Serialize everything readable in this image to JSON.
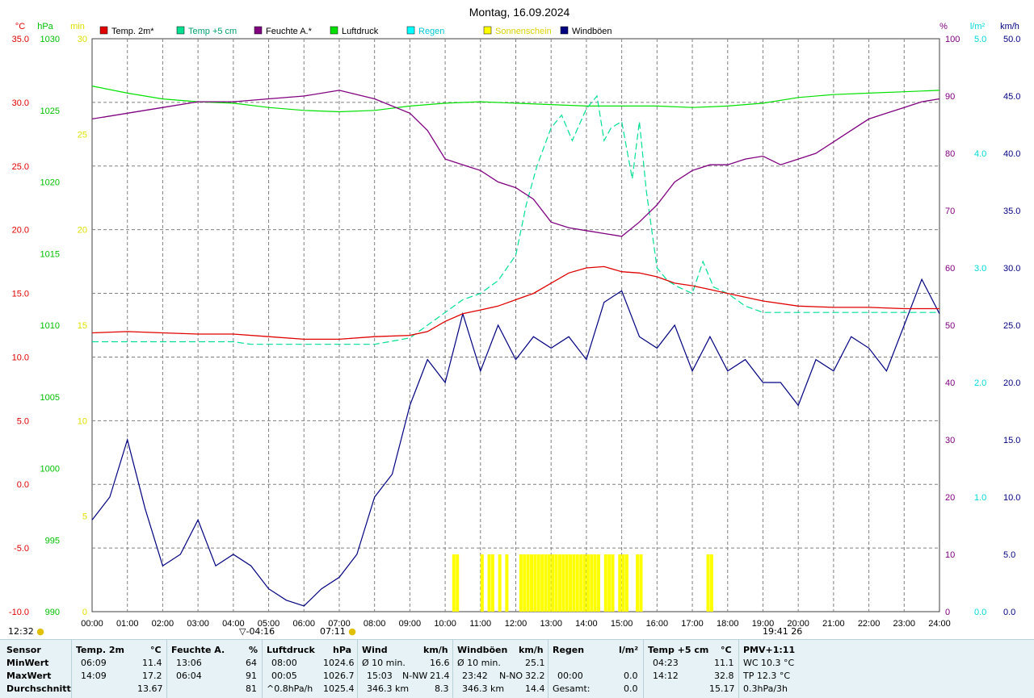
{
  "title": "Montag, 16.09.2024",
  "colors": {
    "temp": "#e00000",
    "temp5": "#00e090",
    "humidity": "#800080",
    "pressure": "#00e000",
    "rain": "#00ffff",
    "sun": "#ffff00",
    "gust": "#000080",
    "grid": "#808080",
    "panel_bg": "#e6f2f5"
  },
  "axes": {
    "temp_unit": "°C",
    "pressure_unit": "hPa",
    "sun_unit": "min",
    "hum_unit": "%",
    "rain_unit": "l/m²",
    "wind_unit": "km/h",
    "temp_ticks": [
      "35.0",
      "30.0",
      "25.0",
      "20.0",
      "15.0",
      "10.0",
      "5.0",
      "0.0",
      "-5.0",
      "-10.0"
    ],
    "pressure_ticks": [
      "1030",
      "1025",
      "1020",
      "1015",
      "1010",
      "1005",
      "1000",
      "995",
      "990"
    ],
    "sun_ticks": [
      "30",
      "25",
      "20",
      "15",
      "10",
      "5",
      "0"
    ],
    "hum_ticks": [
      "100",
      "90",
      "80",
      "70",
      "60",
      "50",
      "40",
      "30",
      "20",
      "10",
      "0"
    ],
    "rain_ticks": [
      "5.0",
      "4.0",
      "3.0",
      "2.0",
      "1.0",
      "0.0"
    ],
    "wind_ticks": [
      "50.0",
      "45.0",
      "40.0",
      "35.0",
      "30.0",
      "25.0",
      "20.0",
      "15.0",
      "10.0",
      "5.0",
      "0.0"
    ],
    "time_ticks": [
      "00:00",
      "01:00",
      "02:00",
      "03:00",
      "04:00",
      "05:00",
      "06:00",
      "07:00",
      "08:00",
      "09:00",
      "10:00",
      "11:00",
      "12:00",
      "13:00",
      "14:00",
      "15:00",
      "16:00",
      "17:00",
      "18:00",
      "19:00",
      "20:00",
      "21:00",
      "22:00",
      "23:00",
      "24:00"
    ]
  },
  "legend": [
    {
      "label": "Temp. 2m*",
      "color": "#e00000"
    },
    {
      "label": "Temp +5 cm",
      "color": "#00e090"
    },
    {
      "label": "Feuchte A.*",
      "color": "#800080"
    },
    {
      "label": "Luftdruck",
      "color": "#00e000"
    },
    {
      "label": "Regen",
      "color": "#00ffff"
    },
    {
      "label": "Sonnenschein",
      "color": "#ffff00"
    },
    {
      "label": "Windböen",
      "color": "#000080"
    }
  ],
  "markers": {
    "moonrise": "04:16",
    "sunrise": "07:11",
    "sunset": "19:41",
    "sunset_extra": "26",
    "corner_time": "12:32"
  },
  "chart_data": {
    "type": "line",
    "x_unit": "hour",
    "xlim": [
      0,
      24
    ],
    "series": [
      {
        "name": "Temp. 2m*",
        "axis": "°C",
        "ylim": [
          -10,
          35
        ],
        "x": [
          0,
          1,
          2,
          3,
          4,
          5,
          6,
          7,
          8,
          9,
          9.5,
          10,
          10.5,
          11,
          11.5,
          12,
          12.5,
          13,
          13.5,
          14,
          14.5,
          15,
          15.5,
          16,
          16.5,
          17,
          17.5,
          18,
          19,
          20,
          21,
          22,
          23,
          24
        ],
        "y": [
          11.9,
          12.0,
          11.9,
          11.8,
          11.8,
          11.6,
          11.4,
          11.4,
          11.6,
          11.7,
          12.0,
          12.8,
          13.4,
          13.7,
          14.0,
          14.5,
          15.0,
          15.8,
          16.6,
          17.0,
          17.1,
          16.7,
          16.6,
          16.3,
          15.8,
          15.6,
          15.3,
          15.0,
          14.4,
          14.0,
          13.9,
          13.9,
          13.8,
          13.8
        ]
      },
      {
        "name": "Temp +5 cm",
        "axis": "°C",
        "ylim": [
          -10,
          35
        ],
        "x": [
          0,
          1,
          2,
          3,
          4,
          4.5,
          5,
          6,
          7,
          8,
          9,
          9.5,
          10,
          10.5,
          11,
          11.5,
          12,
          12.3,
          12.6,
          13,
          13.3,
          13.6,
          14,
          14.3,
          14.5,
          14.7,
          15,
          15.3,
          15.5,
          15.7,
          16,
          16.3,
          16.6,
          17,
          17.3,
          17.6,
          18,
          18.5,
          19,
          20,
          21,
          22,
          23,
          24
        ],
        "y": [
          11.2,
          11.2,
          11.2,
          11.2,
          11.2,
          11.0,
          11.0,
          11.0,
          11.0,
          11.0,
          11.5,
          12.5,
          13.5,
          14.5,
          15.0,
          16.0,
          18.0,
          22.0,
          25.0,
          28.0,
          29.0,
          27.0,
          29.5,
          30.5,
          27.0,
          28.0,
          28.5,
          24.0,
          28.5,
          23.0,
          17.0,
          16.0,
          15.5,
          15.0,
          17.5,
          15.5,
          15.0,
          14.0,
          13.5,
          13.5,
          13.5,
          13.5,
          13.5,
          13.5
        ]
      },
      {
        "name": "Feuchte A.*",
        "axis": "%",
        "ylim": [
          0,
          100
        ],
        "x": [
          0,
          1,
          2,
          3,
          4,
          5,
          6,
          7,
          8,
          9,
          9.5,
          10,
          10.5,
          11,
          11.5,
          12,
          12.5,
          13,
          13.5,
          14,
          14.5,
          15,
          15.5,
          16,
          16.5,
          17,
          17.5,
          18,
          18.5,
          19,
          19.5,
          20,
          20.5,
          21,
          21.5,
          22,
          22.5,
          23,
          23.5,
          24
        ],
        "y": [
          86,
          87,
          88,
          89,
          89,
          89.5,
          90,
          91,
          89.5,
          87,
          84,
          79,
          78,
          77,
          75,
          74,
          72,
          68,
          67,
          66.5,
          66,
          65.5,
          68,
          71,
          75,
          77,
          78,
          78,
          79,
          79.5,
          78,
          79,
          80,
          82,
          84,
          86,
          87,
          88,
          89,
          89.5
        ]
      },
      {
        "name": "Luftdruck",
        "axis": "hPa",
        "ylim": [
          990,
          1030
        ],
        "x": [
          0,
          1,
          2,
          3,
          4,
          5,
          6,
          7,
          8,
          9,
          10,
          11,
          12,
          13,
          14,
          15,
          16,
          17,
          18,
          19,
          20,
          21,
          22,
          23,
          24
        ],
        "y": [
          1026.7,
          1026.2,
          1025.8,
          1025.6,
          1025.5,
          1025.2,
          1025.0,
          1024.9,
          1025.0,
          1025.3,
          1025.5,
          1025.6,
          1025.5,
          1025.4,
          1025.3,
          1025.3,
          1025.3,
          1025.2,
          1025.3,
          1025.5,
          1025.9,
          1026.1,
          1026.2,
          1026.3,
          1026.4
        ]
      },
      {
        "name": "Windböen",
        "axis": "km/h",
        "ylim": [
          0,
          50
        ],
        "x": [
          0,
          0.5,
          1,
          1.5,
          2,
          2.5,
          3,
          3.5,
          4,
          4.5,
          5,
          5.5,
          6,
          6.5,
          7,
          7.5,
          8,
          8.5,
          9,
          9.5,
          10,
          10.5,
          11,
          11.5,
          12,
          12.5,
          13,
          13.5,
          14,
          14.5,
          15,
          15.5,
          16,
          16.5,
          17,
          17.5,
          18,
          18.5,
          19,
          19.5,
          20,
          20.5,
          21,
          21.5,
          22,
          22.5,
          23,
          23.5,
          24
        ],
        "y": [
          8,
          10,
          15,
          9,
          4,
          5,
          8,
          4,
          5,
          4,
          2,
          1,
          0.5,
          2,
          3,
          5,
          10,
          12,
          18,
          22,
          20,
          26,
          21,
          25,
          22,
          24,
          23,
          24,
          22,
          27,
          28,
          24,
          23,
          25,
          21,
          24,
          21,
          22,
          20,
          20,
          18,
          22,
          21,
          24,
          23,
          21,
          25,
          29,
          26
        ]
      },
      {
        "name": "Sonnenschein",
        "axis": "min",
        "ylim": [
          0,
          30
        ],
        "x": [
          10.2,
          10.3,
          11.0,
          11.2,
          11.3,
          11.5,
          11.7,
          12.1,
          12.2,
          12.3,
          12.4,
          12.5,
          12.6,
          12.7,
          12.8,
          12.9,
          13.0,
          13.1,
          13.2,
          13.3,
          13.4,
          13.5,
          13.6,
          13.7,
          13.8,
          13.9,
          14.0,
          14.1,
          14.2,
          14.3,
          14.5,
          14.6,
          14.7,
          14.9,
          15.0,
          15.1,
          15.4,
          15.5,
          17.4,
          17.5
        ],
        "y": [
          3,
          3,
          3,
          3,
          3,
          3,
          3,
          3,
          3,
          3,
          3,
          3,
          3,
          3,
          3,
          3,
          3,
          3,
          3,
          3,
          3,
          3,
          3,
          3,
          3,
          3,
          3,
          3,
          3,
          3,
          3,
          3,
          3,
          3,
          3,
          3,
          3,
          3,
          3,
          3
        ]
      }
    ],
    "grid": true,
    "legend_position": "top"
  },
  "stats": {
    "sensor": {
      "title": "Sensor",
      "rows": [
        "MinWert",
        "MaxWert",
        "Durchschnitt"
      ]
    },
    "temp": {
      "title": "Temp. 2m",
      "unit": "°C",
      "rows": [
        [
          "06:09",
          "11.4"
        ],
        [
          "14:09",
          "17.2"
        ],
        [
          "",
          "13.67"
        ]
      ]
    },
    "hum": {
      "title": "Feuchte A.",
      "unit": "%",
      "rows": [
        [
          "13:06",
          "64"
        ],
        [
          "06:04",
          "91"
        ],
        [
          "",
          "81"
        ]
      ]
    },
    "press": {
      "title": "Luftdruck",
      "unit": "hPa",
      "rows": [
        [
          "08:00",
          "1024.6"
        ],
        [
          "00:05",
          "1026.7"
        ],
        [
          "^0.8hPa/h",
          "1025.4"
        ]
      ]
    },
    "wind": {
      "title": "Wind",
      "unit": "km/h",
      "rows": [
        [
          "Ø 10 min.",
          "",
          "16.6"
        ],
        [
          "15:03",
          "N-NW",
          "21.4"
        ],
        [
          "346.3 km",
          "",
          "8.3"
        ]
      ]
    },
    "gust": {
      "title": "Windböen",
      "unit": "km/h",
      "rows": [
        [
          "Ø 10 min.",
          "",
          "25.1"
        ],
        [
          "23:42",
          "N-NO",
          "32.2"
        ],
        [
          "346.3 km",
          "",
          "14.4"
        ]
      ]
    },
    "rain": {
      "title": "Regen",
      "unit": "l/m²",
      "rows": [
        [
          "",
          ""
        ],
        [
          "00:00",
          "0.0"
        ],
        [
          "Gesamt:",
          "0.0"
        ]
      ]
    },
    "temp5": {
      "title": "Temp +5 cm",
      "unit": "°C",
      "rows": [
        [
          "04:23",
          "11.1"
        ],
        [
          "14:12",
          "32.8"
        ],
        [
          "",
          "15.17"
        ]
      ]
    },
    "pmv": {
      "title": "PMV+1:11",
      "rows": [
        "WC 10.3 °C",
        "TP 12.3 °C",
        "0.3hPa/3h"
      ]
    }
  }
}
